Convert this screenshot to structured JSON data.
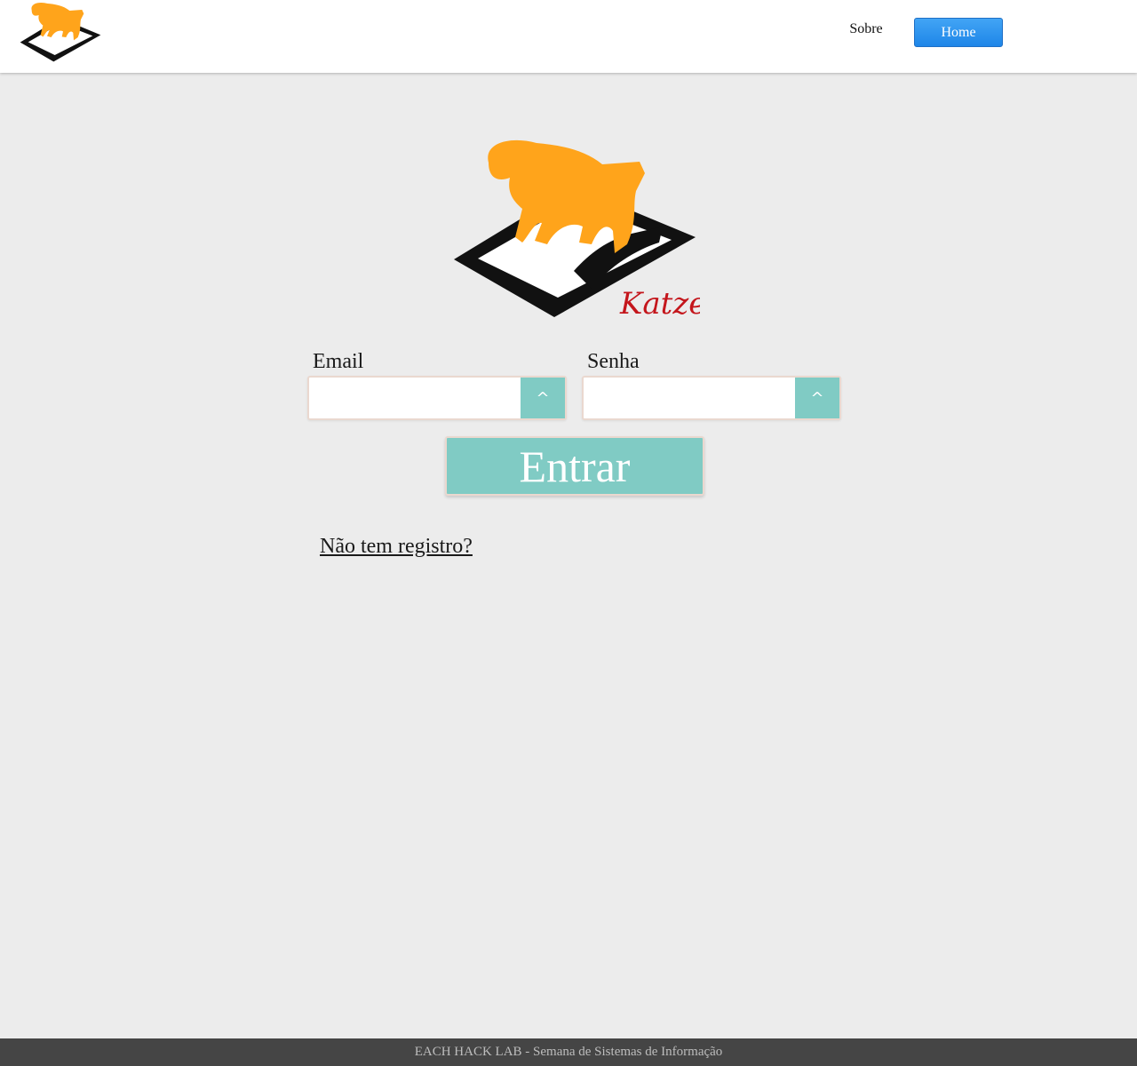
{
  "header": {
    "logo_icon": "cat-on-book-logo-icon",
    "nav": {
      "sobre_label": "Sobre",
      "home_label": "Home"
    },
    "colors": {
      "home_button": "#1e86e8"
    }
  },
  "hero": {
    "logo_icon": "katze-cat-book-logo-icon",
    "logo_text": "Katze"
  },
  "form": {
    "email_label": "Email",
    "password_label": "Senha",
    "email_value": "",
    "password_value": "",
    "caret_icon": "caret-up-icon",
    "submit_label": "Entrar",
    "register_link": "Não tem registro?",
    "colors": {
      "accent": "#80cbc4"
    }
  },
  "footer": {
    "text": "EACH HACK LAB - Semana de Sistemas de Informação"
  }
}
